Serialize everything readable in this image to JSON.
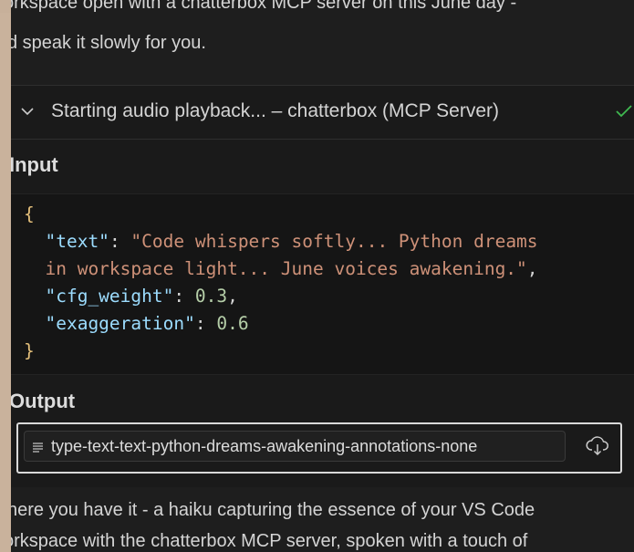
{
  "conversation": {
    "intro_line_1": "orkspace open with a chatterbox MCP server on this June day -",
    "intro_line_2": "d speak it slowly for you.",
    "outro_line_1": "here you have it - a haiku capturing the essence of your VS Code",
    "outro_line_2": "orkspace with the chatterbox MCP server, spoken with a touch of"
  },
  "tool_call": {
    "title": "Starting audio playback... – chatterbox (MCP Server)",
    "status": "check-icon",
    "input_label": "Input",
    "output_label": "Output",
    "input_code": {
      "open_brace": "{",
      "text_key": "\"text\"",
      "text_value_line_1": "\"Code whispers softly... Python dreams",
      "text_value_line_2": "in workspace light... June voices awakening.\"",
      "cfg_key": "\"cfg_weight\"",
      "cfg_value": "0.3",
      "exaggeration_key": "\"exaggeration\"",
      "exaggeration_value": "0.6",
      "close_brace": "}"
    },
    "output_file": {
      "name": "type-text-text-python-dreams-awakening-annotations-none",
      "icon": "list-lines-icon",
      "action_icon": "cloud-download-icon"
    }
  },
  "colors": {
    "background": "#1e1e1e",
    "code_background": "#151515",
    "brace": "#e5c07b",
    "json_key": "#9cdcfe",
    "json_string": "#ce9178",
    "json_number": "#b5cea8",
    "success": "#3fb950"
  }
}
